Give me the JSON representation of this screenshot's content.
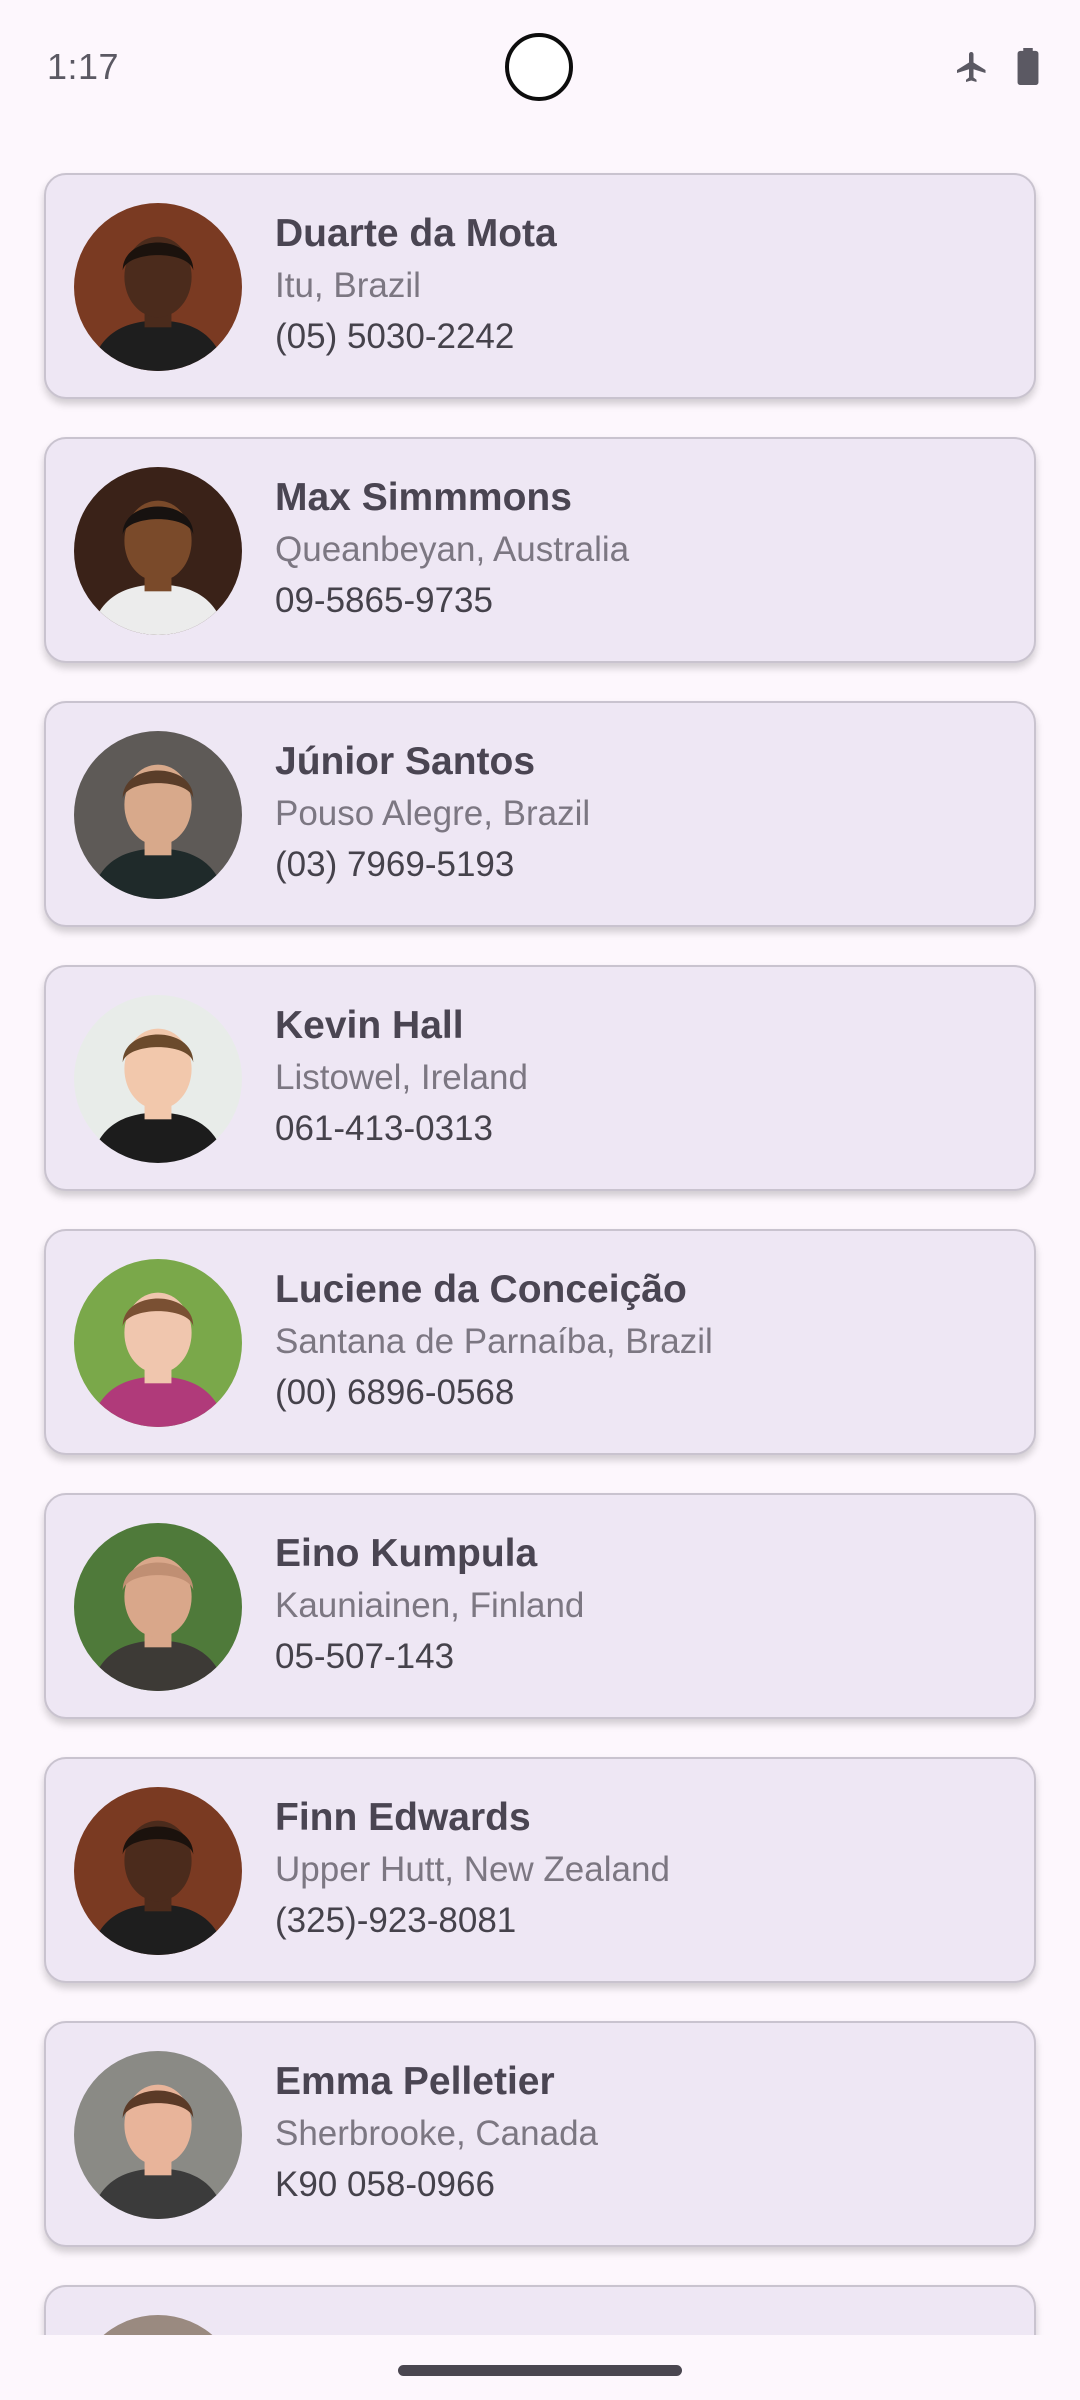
{
  "status_bar": {
    "time": "1:17",
    "icons": [
      "airplane-mode-icon",
      "battery-icon"
    ]
  },
  "contacts": [
    {
      "name": "Duarte da Mota",
      "location": "Itu, Brazil",
      "phone": "(05) 5030-2242",
      "avatar": {
        "skin": "#4b2b1c",
        "hair": "#1b120d",
        "shirt": "#1e1e1e",
        "bg": "#7a3a22"
      }
    },
    {
      "name": "Max Simmmons",
      "location": "Queanbeyan, Australia",
      "phone": "09-5865-9735",
      "avatar": {
        "skin": "#7a4a2a",
        "hair": "#171210",
        "shirt": "#ececec",
        "bg": "#3a2218"
      }
    },
    {
      "name": "Júnior Santos",
      "location": "Pouso Alegre, Brazil",
      "phone": "(03) 7969-5193",
      "avatar": {
        "skin": "#d8a98b",
        "hair": "#5a3d29",
        "shirt": "#1f2a2a",
        "bg": "#5e5a57"
      }
    },
    {
      "name": "Kevin Hall",
      "location": "Listowel, Ireland",
      "phone": "061-413-0313",
      "avatar": {
        "skin": "#f2c8ac",
        "hair": "#6b4a2c",
        "shirt": "#1c1c1c",
        "bg": "#e8ece9"
      }
    },
    {
      "name": "Luciene da Conceição",
      "location": "Santana de Parnaíba, Brazil",
      "phone": "(00) 6896-0568",
      "avatar": {
        "skin": "#f0c6ae",
        "hair": "#7a5033",
        "shirt": "#b03a7a",
        "bg": "#7aa84a"
      }
    },
    {
      "name": "Eino Kumpula",
      "location": "Kauniainen, Finland",
      "phone": "05-507-143",
      "avatar": {
        "skin": "#d9a78a",
        "hair": "#c08f73",
        "shirt": "#3d3a36",
        "bg": "#4f7a3a"
      }
    },
    {
      "name": "Finn Edwards",
      "location": "Upper Hutt, New Zealand",
      "phone": "(325)-923-8081",
      "avatar": {
        "skin": "#4b2b1c",
        "hair": "#1b120d",
        "shirt": "#1e1e1e",
        "bg": "#7a3a22"
      }
    },
    {
      "name": "Emma Pelletier",
      "location": "Sherbrooke, Canada",
      "phone": "K90 058-0966",
      "avatar": {
        "skin": "#e8b49a",
        "hair": "#5b3a27",
        "shirt": "#3b3b3b",
        "bg": "#8a8a85"
      }
    },
    {
      "name": "",
      "location": "",
      "phone": "",
      "avatar": {
        "skin": "#e0b8a0",
        "hair": "#6a4535",
        "shirt": "#444444",
        "bg": "#9a8a80"
      }
    }
  ],
  "colors": {
    "background": "#fdf7fd",
    "card": "#eee7f4",
    "card_border": "#c9c3cf",
    "name_text": "#4a4552",
    "location_text": "#7c7782",
    "phone_text": "#45424b"
  }
}
